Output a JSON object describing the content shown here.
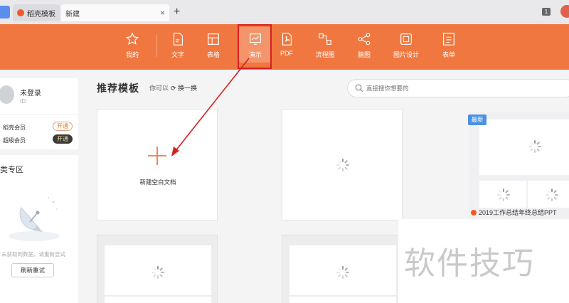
{
  "tabs": {
    "inactive_label": "稻壳模板",
    "active_label": "新建",
    "close_glyph": "×",
    "new_tab_glyph": "+"
  },
  "window": {
    "count_badge": "1"
  },
  "toolbar": {
    "items": [
      {
        "label": "我的",
        "icon": "star-icon"
      },
      {
        "label": "文字",
        "icon": "document-icon"
      },
      {
        "label": "表格",
        "icon": "table-icon"
      },
      {
        "label": "演示",
        "icon": "presentation-icon"
      },
      {
        "label": "PDF",
        "icon": "pdf-icon"
      },
      {
        "label": "流程图",
        "icon": "flowchart-icon"
      },
      {
        "label": "脑图",
        "icon": "mindmap-icon"
      },
      {
        "label": "图片设计",
        "icon": "image-design-icon"
      },
      {
        "label": "表单",
        "icon": "form-icon"
      }
    ],
    "selected": "演示"
  },
  "sidebar": {
    "user": {
      "name": "未登录",
      "id_label": "ID:"
    },
    "memberships": [
      {
        "label": "稻壳会员",
        "action": "开通"
      },
      {
        "label": "超级会员",
        "action": "开通"
      }
    ],
    "category": {
      "title": "类专区",
      "empty_text": "未获取到数据，请重新尝试",
      "retry_label": "刷新重试"
    }
  },
  "main": {
    "title": "推荐模板",
    "hint": "你可以",
    "refresh_label": "换一换",
    "search_placeholder": "直接搜你想要的",
    "blank_label": "新建空白文档",
    "template": {
      "badge": "最新",
      "caption": "2019工作总结年终总结PPT"
    }
  },
  "watermark": "软件技巧",
  "colors": {
    "toolbar": "#f07740",
    "highlight": "#d62020",
    "accent": "#ef5a28",
    "badge": "#4a90e2"
  }
}
